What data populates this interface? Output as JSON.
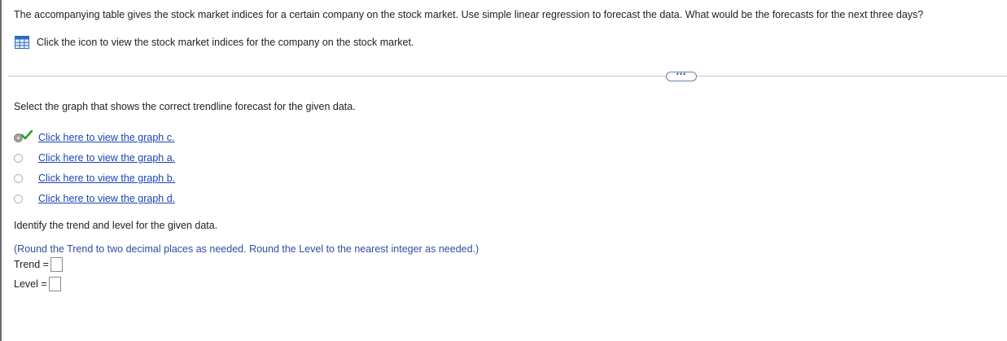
{
  "question": {
    "text": "The accompanying table gives the stock market indices for a certain company on the stock market. Use simple linear regression to forecast the data. What would be the forecasts for the next three days?",
    "table_link_text": "Click the icon to view the stock market indices for the company on the stock market.",
    "table_icon": "table-grid-icon"
  },
  "more_button": {
    "label": "•••"
  },
  "part1": {
    "prompt": "Select the graph that shows the correct trendline forecast for the given data.",
    "options": [
      {
        "label": "Click here to view the graph c.",
        "selected": true,
        "correct": true
      },
      {
        "label": "Click here to view the graph a.",
        "selected": false
      },
      {
        "label": "Click here to view the graph b.",
        "selected": false
      },
      {
        "label": "Click here to view the graph d.",
        "selected": false
      }
    ]
  },
  "part2": {
    "prompt": "Identify the trend and level for the given data.",
    "rounding_note": "(Round the Trend to two decimal places as needed. Round the Level to the nearest integer as needed.)",
    "trend_label": "Trend =",
    "trend_value": "",
    "level_label": "Level =",
    "level_value": ""
  },
  "colors": {
    "link": "#1c44b5",
    "note": "#2d4fa0",
    "check": "#2e9e2e",
    "icon": "#2b6cc4"
  }
}
